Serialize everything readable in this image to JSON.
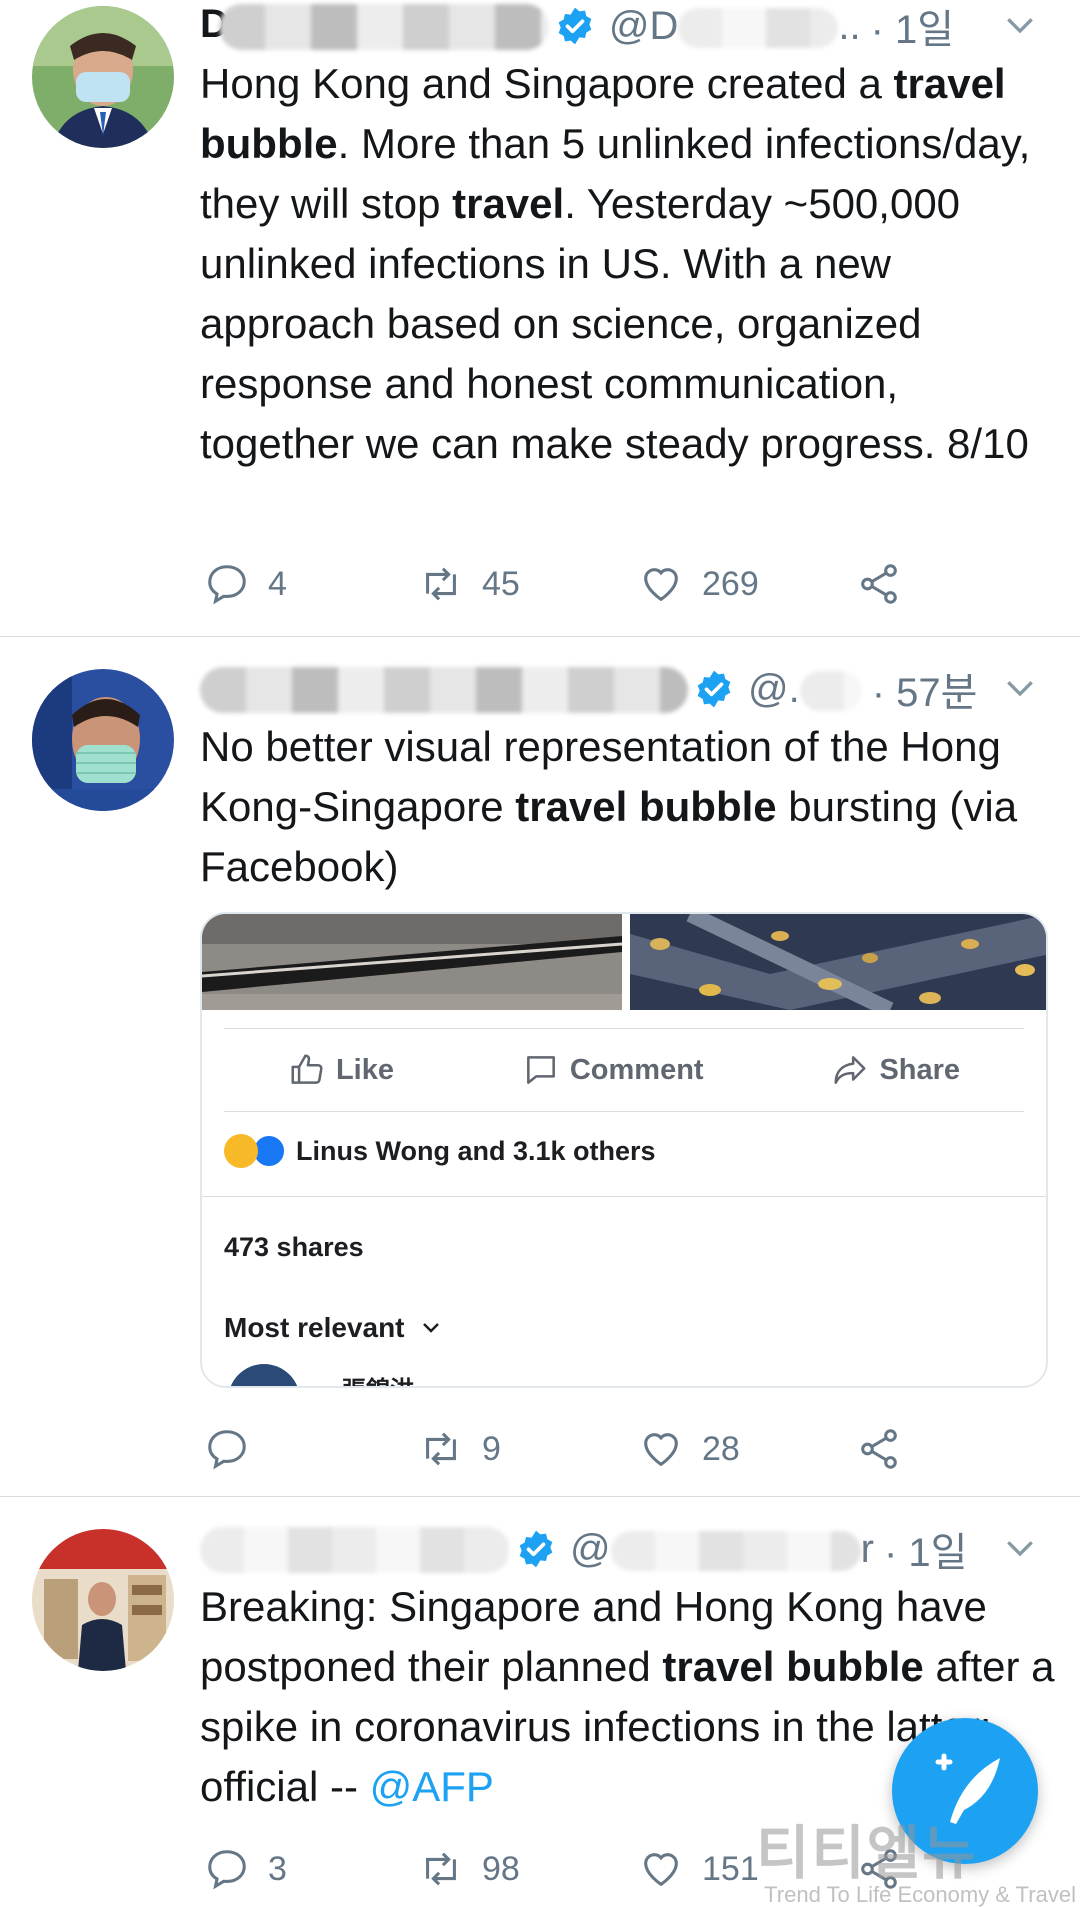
{
  "tweets": [
    {
      "handle": "@D",
      "handle_suffix": "..",
      "time": "· 1일",
      "name_initial": "D",
      "text_segments": [
        {
          "t": "Hong Kong and Singapore created a ",
          "b": false
        },
        {
          "t": "travel bubble",
          "b": true
        },
        {
          "t": ". More than 5 unlinked infections/day, they will stop ",
          "b": false
        },
        {
          "t": "travel",
          "b": true
        },
        {
          "t": ". Yesterday ~500,000 unlinked infections in US. With a new approach based on science, organized response and honest communication, together we can make steady progress. 8/10",
          "b": false
        }
      ],
      "replies": "4",
      "retweets": "45",
      "likes": "269"
    },
    {
      "handle": "@.",
      "time": "· 57분",
      "text_segments": [
        {
          "t": "No better visual representation of the Hong Kong-Singapore ",
          "b": false
        },
        {
          "t": "travel bubble",
          "b": true
        },
        {
          "t": " bursting (via Facebook)",
          "b": false
        }
      ],
      "card": {
        "like_label": "Like",
        "comment_label": "Comment",
        "share_label": "Share",
        "reactions_text": "Linus Wong and 3.1k others",
        "shares_text": "473 shares",
        "sort_label": "Most relevant",
        "commenter_name": "張錦洪"
      },
      "replies": "",
      "retweets": "9",
      "likes": "28"
    },
    {
      "handle": "@",
      "handle_suffix": "r",
      "time": "· 1일",
      "text_segments": [
        {
          "t": "Breaking: Singapore and Hong Kong have postponed their planned ",
          "b": false
        },
        {
          "t": "travel bubble",
          "b": true
        },
        {
          "t": " after a spike in coronavirus infections in the latter: official -- ",
          "b": false
        }
      ],
      "mention": "@AFP",
      "replies": "3",
      "retweets": "98",
      "likes": "151"
    }
  ],
  "watermark": {
    "main": "티티엘뉴스",
    "sub": "Trend To Life Economy & Travel"
  },
  "colors": {
    "accent": "#1da1f2",
    "text": "#14171a",
    "muted": "#657786",
    "divider": "#d8dde1"
  }
}
